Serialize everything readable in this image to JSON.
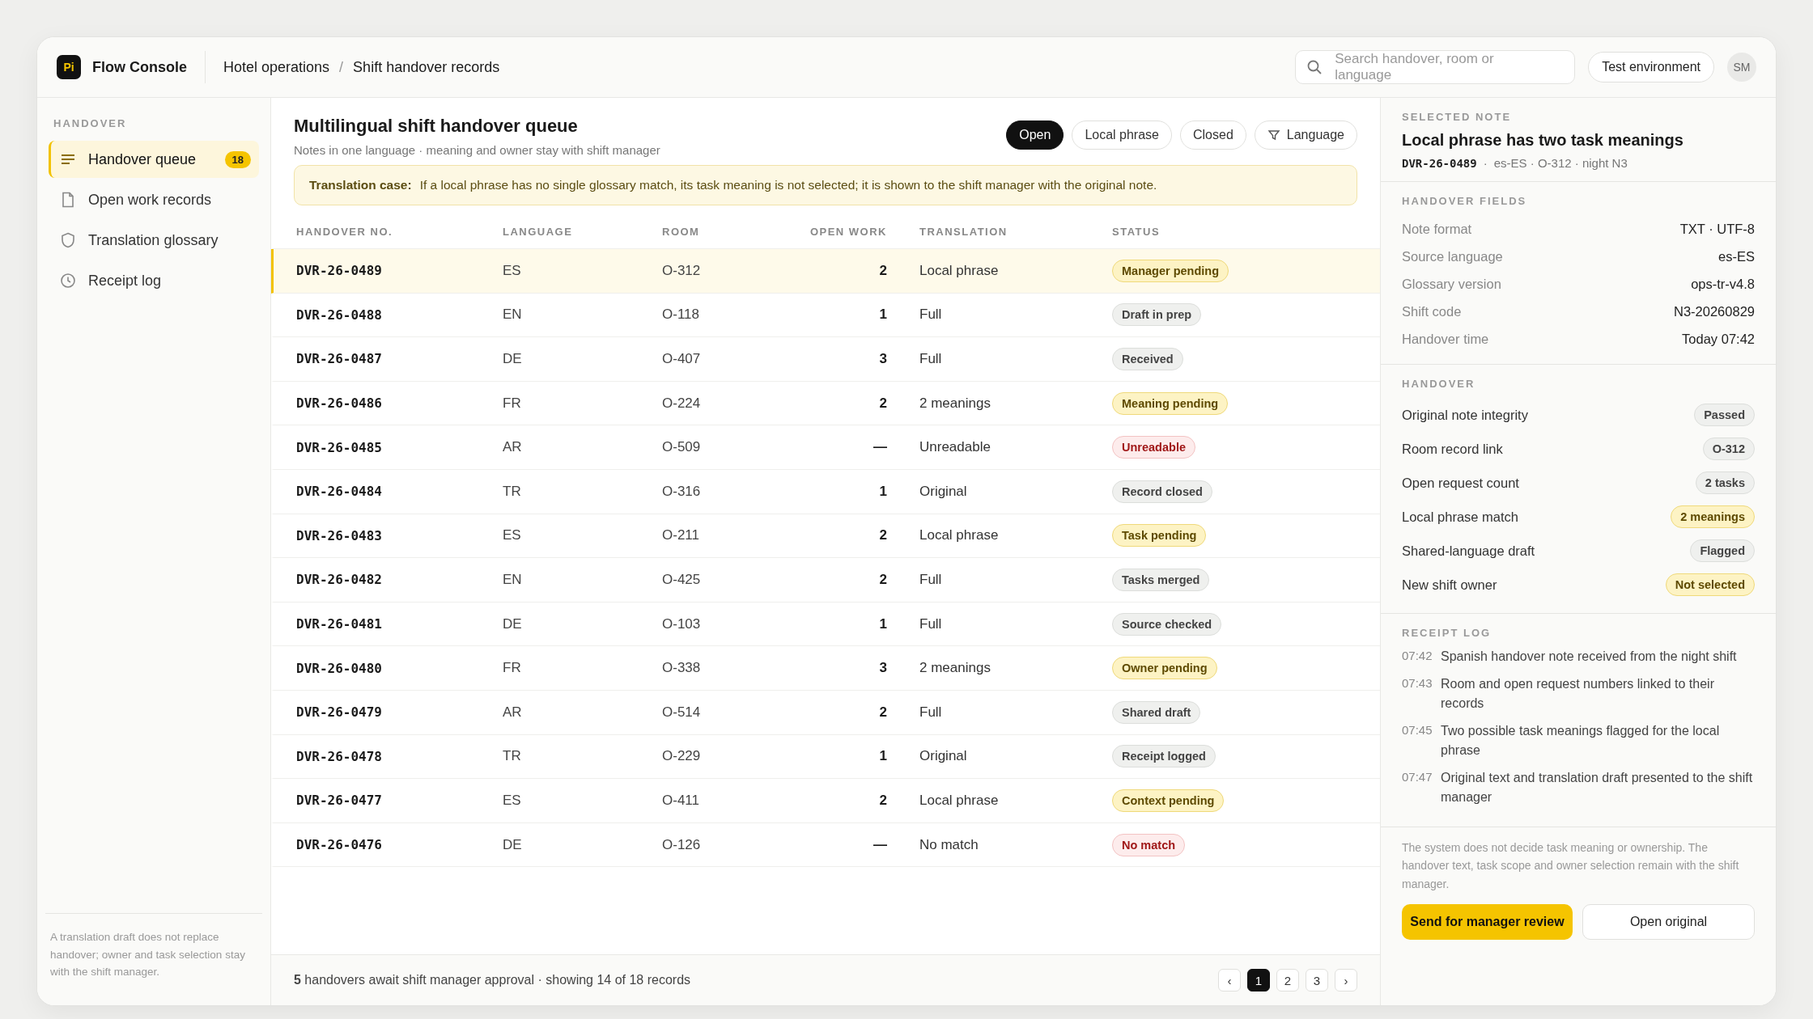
{
  "app": {
    "logo": "Pi",
    "name": "Flow Console"
  },
  "breadcrumb": {
    "items": [
      "Hotel operations",
      "Shift handover records"
    ],
    "separator": "/"
  },
  "search": {
    "placeholder": "Search handover, room or language"
  },
  "environment": "Test environment",
  "avatar": "SM",
  "sidebar": {
    "heading": "HANDOVER",
    "items": [
      {
        "label": "Handover queue",
        "kind": "list",
        "badge": "18",
        "selected": true
      },
      {
        "label": "Open work records",
        "kind": "document",
        "selected": false
      },
      {
        "label": "Translation glossary",
        "kind": "shield",
        "selected": false
      },
      {
        "label": "Receipt log",
        "kind": "clock",
        "selected": false
      }
    ],
    "note": "A translation draft does not replace handover; owner and task selection stay with the shift manager."
  },
  "main": {
    "title": "Multilingual shift handover queue",
    "subtitle": "Notes in one language · meaning and owner stay with shift manager",
    "filters": [
      {
        "label": "Open",
        "selected": true
      },
      {
        "label": "Local phrase",
        "selected": false
      },
      {
        "label": "Closed",
        "selected": false
      },
      {
        "label": "Language",
        "selected": false,
        "kind": "filter"
      }
    ],
    "notice": {
      "label": "Translation case:",
      "text": "If a local phrase has no single glossary match, its task meaning is not selected; it is shown to the shift manager with the original note."
    }
  },
  "table": {
    "columns": [
      "HANDOVER NO.",
      "LANGUAGE",
      "ROOM",
      "OPEN WORK",
      "TRANSLATION",
      "STATUS"
    ],
    "rows": [
      {
        "id": "DVR-26-0489",
        "language": "ES",
        "room": "O-312",
        "open_work": "2",
        "translation": "Local phrase",
        "status": "Manager pending",
        "kind": "warn",
        "selected": true
      },
      {
        "id": "DVR-26-0488",
        "language": "EN",
        "room": "O-118",
        "open_work": "1",
        "translation": "Full",
        "status": "Draft in prep",
        "kind": "neutral",
        "selected": false
      },
      {
        "id": "DVR-26-0487",
        "language": "DE",
        "room": "O-407",
        "open_work": "3",
        "translation": "Full",
        "status": "Received",
        "kind": "neutral",
        "selected": false
      },
      {
        "id": "DVR-26-0486",
        "language": "FR",
        "room": "O-224",
        "open_work": "2",
        "translation": "2 meanings",
        "status": "Meaning pending",
        "kind": "warn",
        "selected": false
      },
      {
        "id": "DVR-26-0485",
        "language": "AR",
        "room": "O-509",
        "open_work": "—",
        "translation": "Unreadable",
        "status": "Unreadable",
        "kind": "error",
        "selected": false
      },
      {
        "id": "DVR-26-0484",
        "language": "TR",
        "room": "O-316",
        "open_work": "1",
        "translation": "Original",
        "status": "Record closed",
        "kind": "neutral",
        "selected": false
      },
      {
        "id": "DVR-26-0483",
        "language": "ES",
        "room": "O-211",
        "open_work": "2",
        "translation": "Local phrase",
        "status": "Task pending",
        "kind": "warn",
        "selected": false
      },
      {
        "id": "DVR-26-0482",
        "language": "EN",
        "room": "O-425",
        "open_work": "2",
        "translation": "Full",
        "status": "Tasks merged",
        "kind": "neutral",
        "selected": false
      },
      {
        "id": "DVR-26-0481",
        "language": "DE",
        "room": "O-103",
        "open_work": "1",
        "translation": "Full",
        "status": "Source checked",
        "kind": "neutral",
        "selected": false
      },
      {
        "id": "DVR-26-0480",
        "language": "FR",
        "room": "O-338",
        "open_work": "3",
        "translation": "2 meanings",
        "status": "Owner pending",
        "kind": "warn",
        "selected": false
      },
      {
        "id": "DVR-26-0479",
        "language": "AR",
        "room": "O-514",
        "open_work": "2",
        "translation": "Full",
        "status": "Shared draft",
        "kind": "neutral",
        "selected": false
      },
      {
        "id": "DVR-26-0478",
        "language": "TR",
        "room": "O-229",
        "open_work": "1",
        "translation": "Original",
        "status": "Receipt logged",
        "kind": "neutral",
        "selected": false
      },
      {
        "id": "DVR-26-0477",
        "language": "ES",
        "room": "O-411",
        "open_work": "2",
        "translation": "Local phrase",
        "status": "Context pending",
        "kind": "warn",
        "selected": false
      },
      {
        "id": "DVR-26-0476",
        "language": "DE",
        "room": "O-126",
        "open_work": "—",
        "translation": "No match",
        "status": "No match",
        "kind": "error",
        "selected": false
      }
    ]
  },
  "footer": {
    "summary": "**5** handovers await shift manager approval · showing 14 of 18 records",
    "prev": "‹",
    "next": "›",
    "pages": [
      {
        "label": "1",
        "selected": true
      },
      {
        "label": "2",
        "selected": false
      },
      {
        "label": "3",
        "selected": false
      }
    ]
  },
  "detail": {
    "heading": "SELECTED NOTE",
    "title": "Local phrase has two task meanings",
    "id": "DVR-26-0489",
    "separator": "·",
    "meta": "es-ES · O-312 · night N3",
    "fields_heading": "HANDOVER FIELDS",
    "fields": [
      {
        "label": "Note format",
        "value": "TXT · UTF-8"
      },
      {
        "label": "Source language",
        "value": "es-ES"
      },
      {
        "label": "Glossary version",
        "value": "ops-tr-v4.8"
      },
      {
        "label": "Shift code",
        "value": "N3-20260829"
      },
      {
        "label": "Handover time",
        "value": "Today 07:42"
      }
    ],
    "checks_heading": "HANDOVER",
    "checks": [
      {
        "label": "Original note integrity",
        "value": "Passed",
        "kind": "neutral"
      },
      {
        "label": "Room record link",
        "value": "O-312",
        "kind": "neutral"
      },
      {
        "label": "Open request count",
        "value": "2 tasks",
        "kind": "neutral"
      },
      {
        "label": "Local phrase match",
        "value": "2 meanings",
        "kind": "warn"
      },
      {
        "label": "Shared-language draft",
        "value": "Flagged",
        "kind": "neutral"
      },
      {
        "label": "New shift owner",
        "value": "Not selected",
        "kind": "warn"
      }
    ],
    "log_heading": "RECEIPT LOG",
    "log": [
      {
        "time": "07:42",
        "text": "Spanish handover note received from the night shift"
      },
      {
        "time": "07:43",
        "text": "Room and open request numbers linked to their records"
      },
      {
        "time": "07:45",
        "text": "Two possible task meanings flagged for the local phrase"
      },
      {
        "time": "07:47",
        "text": "Original text and translation draft presented to the shift manager"
      }
    ],
    "disclaimer": "The system does not decide task meaning or ownership. The handover text, task scope and owner selection remain with the shift manager.",
    "primary_button": "Send for manager review",
    "secondary_button": "Open original"
  }
}
